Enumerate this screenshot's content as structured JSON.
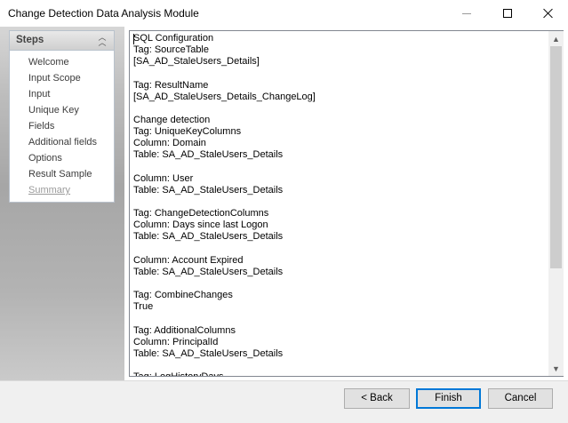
{
  "window": {
    "title": "Change Detection Data Analysis Module"
  },
  "steps": {
    "title": "Steps",
    "items": [
      {
        "label": "Welcome",
        "current": false
      },
      {
        "label": "Input Scope",
        "current": false
      },
      {
        "label": "Input",
        "current": false
      },
      {
        "label": "Unique Key",
        "current": false
      },
      {
        "label": "Fields",
        "current": false
      },
      {
        "label": "Additional fields",
        "current": false
      },
      {
        "label": "Options",
        "current": false
      },
      {
        "label": "Result Sample",
        "current": false
      },
      {
        "label": "Summary",
        "current": true
      }
    ]
  },
  "summary": {
    "lines": [
      "SQL Configuration",
      "Tag: SourceTable",
      "[SA_AD_StaleUsers_Details]",
      "",
      "Tag: ResultName",
      "[SA_AD_StaleUsers_Details_ChangeLog]",
      "",
      "Change detection",
      "Tag: UniqueKeyColumns",
      "Column: Domain",
      "Table: SA_AD_StaleUsers_Details",
      "",
      "Column: User",
      "Table: SA_AD_StaleUsers_Details",
      "",
      "Tag: ChangeDetectionColumns",
      "Column: Days since last Logon",
      "Table: SA_AD_StaleUsers_Details",
      "",
      "Column: Account Expired",
      "Table: SA_AD_StaleUsers_Details",
      "",
      "Tag: CombineChanges",
      "True",
      "",
      "Tag: AdditionalColumns",
      "Column: PrincipalId",
      "Table: SA_AD_StaleUsers_Details",
      "",
      "Tag: LogHistoryDays"
    ]
  },
  "buttons": {
    "back": "< Back",
    "finish": "Finish",
    "cancel": "Cancel"
  }
}
